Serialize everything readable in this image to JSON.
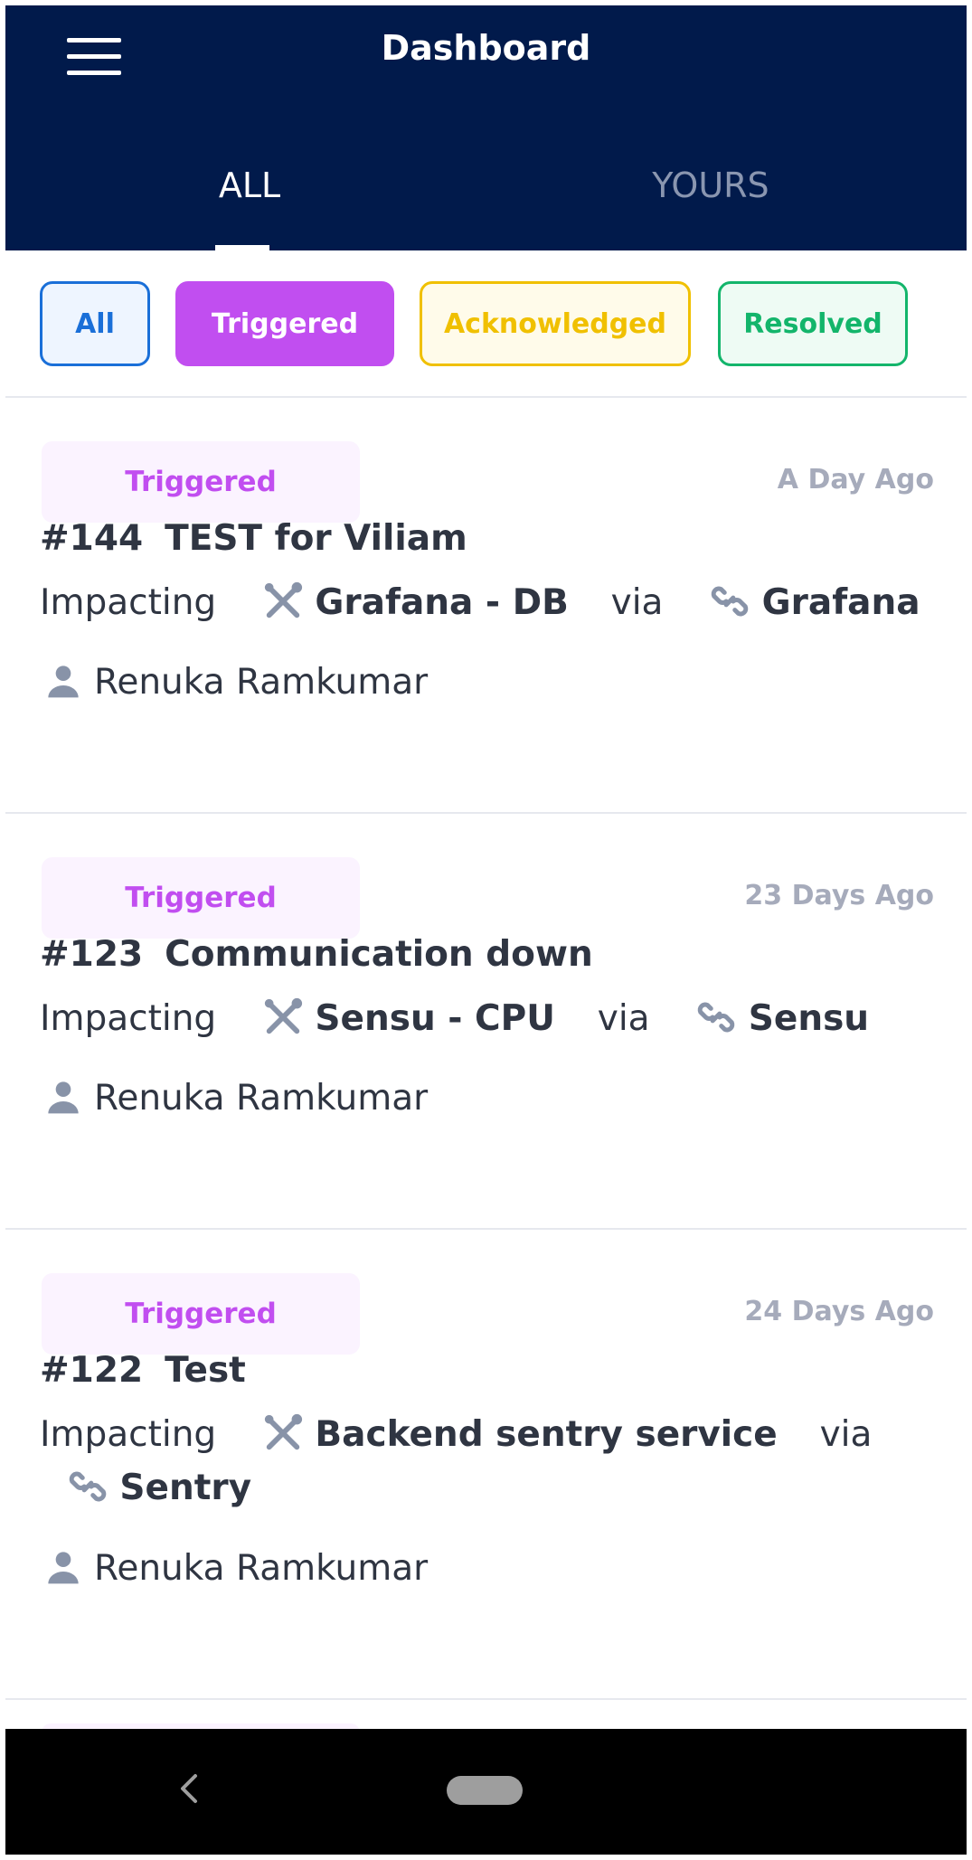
{
  "header": {
    "title": "Dashboard"
  },
  "tabs": [
    {
      "label": "ALL",
      "active": true
    },
    {
      "label": "YOURS",
      "active": false
    }
  ],
  "filters": [
    {
      "label": "All",
      "color": "#1a6fd8",
      "bg": "#eef5ff"
    },
    {
      "label": "Triggered",
      "color": "#ffffff",
      "bg": "#c14ef0",
      "selected": true
    },
    {
      "label": "Acknowledged",
      "color": "#f0c000",
      "bg": "#fffbea"
    },
    {
      "label": "Resolved",
      "color": "#13b56b",
      "bg": "#eefbf4"
    }
  ],
  "incidents": [
    {
      "status": "Triggered",
      "time": "A Day Ago",
      "number": "#144",
      "title": "TEST for Viliam",
      "impacting_label": "Impacting",
      "service": "Grafana - DB",
      "via_label": "via",
      "source": "Grafana",
      "assignee": "Renuka Ramkumar"
    },
    {
      "status": "Triggered",
      "time": "23 Days Ago",
      "number": "#123",
      "title": "Communication down",
      "impacting_label": "Impacting",
      "service": "Sensu - CPU",
      "via_label": "via",
      "source": "Sensu",
      "assignee": "Renuka Ramkumar"
    },
    {
      "status": "Triggered",
      "time": "24 Days Ago",
      "number": "#122",
      "title": "Test",
      "impacting_label": "Impacting",
      "service": "Backend sentry service",
      "via_label": "via",
      "source": "Sentry",
      "assignee": "Renuka Ramkumar"
    }
  ],
  "icons": {
    "menu": "hamburger-menu-icon",
    "service": "tools-icon",
    "source": "link-icon",
    "assignee": "user-icon",
    "back": "back-chevron-icon",
    "home": "home-pill-icon"
  },
  "colors": {
    "appbar": "#011a4b",
    "triggered": "#c14ef0",
    "muted_icon": "#8893a8"
  }
}
